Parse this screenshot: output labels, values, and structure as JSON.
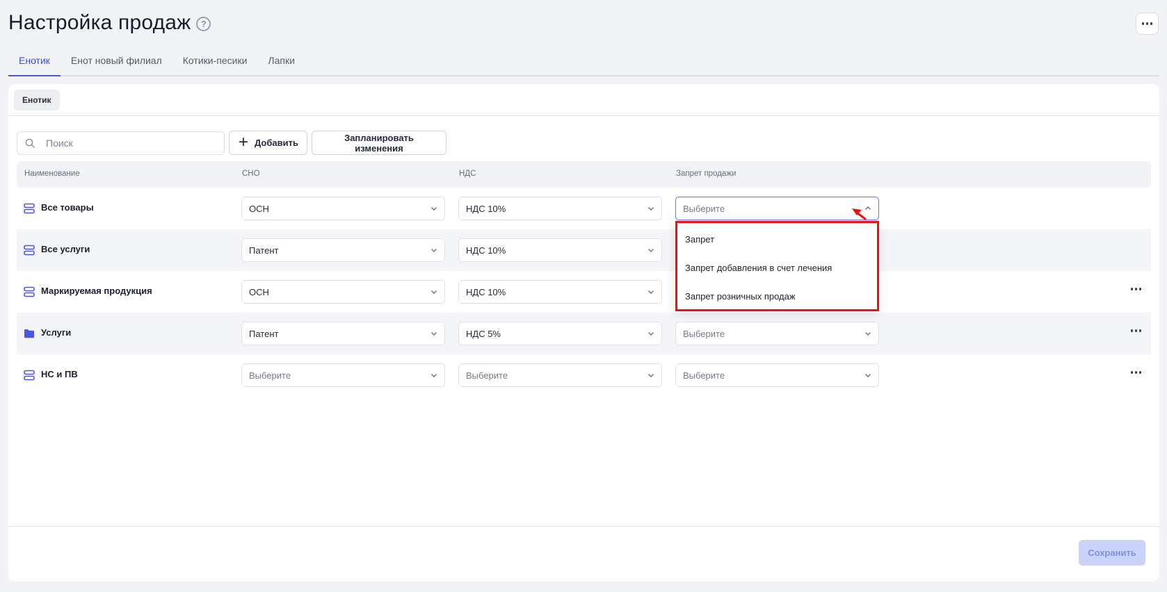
{
  "page": {
    "title": "Настройка продаж",
    "help_icon": "?",
    "more_icon": "ellipsis-icon"
  },
  "tabs": [
    {
      "label": "Енотик",
      "active": true
    },
    {
      "label": "Енот новый филиал",
      "active": false
    },
    {
      "label": "Котики-песики",
      "active": false
    },
    {
      "label": "Лапки",
      "active": false
    }
  ],
  "branch_chip": "Енотик",
  "toolbar": {
    "search_placeholder": "Поиск",
    "add_label": "Добавить",
    "schedule_label": "Запланировать изменения"
  },
  "table": {
    "headers": [
      "Наименование",
      "СНО",
      "НДС",
      "Запрет продажи"
    ],
    "rows": [
      {
        "icon": "stack-icon",
        "name": "Все товары",
        "sno": "ОСН",
        "nds": "НДС 10%",
        "ban": "Выберите",
        "has_more": false
      },
      {
        "icon": "stack-icon",
        "name": "Все услуги",
        "sno": "Патент",
        "nds": "НДС 10%",
        "ban": "",
        "has_more": false
      },
      {
        "icon": "stack-icon",
        "name": "Маркируемая продукция",
        "sno": "ОСН",
        "nds": "НДС 10%",
        "ban": "",
        "has_more": true
      },
      {
        "icon": "folder-icon",
        "name": "Услуги",
        "sno": "Патент",
        "nds": "НДС 5%",
        "ban": "Выберите",
        "has_more": true
      },
      {
        "icon": "stack-icon",
        "name": "НС и ПВ",
        "sno": "Выберите",
        "nds": "Выберите",
        "ban": "Выберите",
        "has_more": true
      }
    ]
  },
  "dropdown": {
    "options": [
      "Запрет",
      "Запрет добавления в счет лечения",
      "Запрет розничных продаж"
    ]
  },
  "footer": {
    "save_label": "Сохранить"
  },
  "colors": {
    "accent": "#4a55e3",
    "annotation": "#ee1111",
    "save_disabled_bg": "#c9d3fb"
  }
}
